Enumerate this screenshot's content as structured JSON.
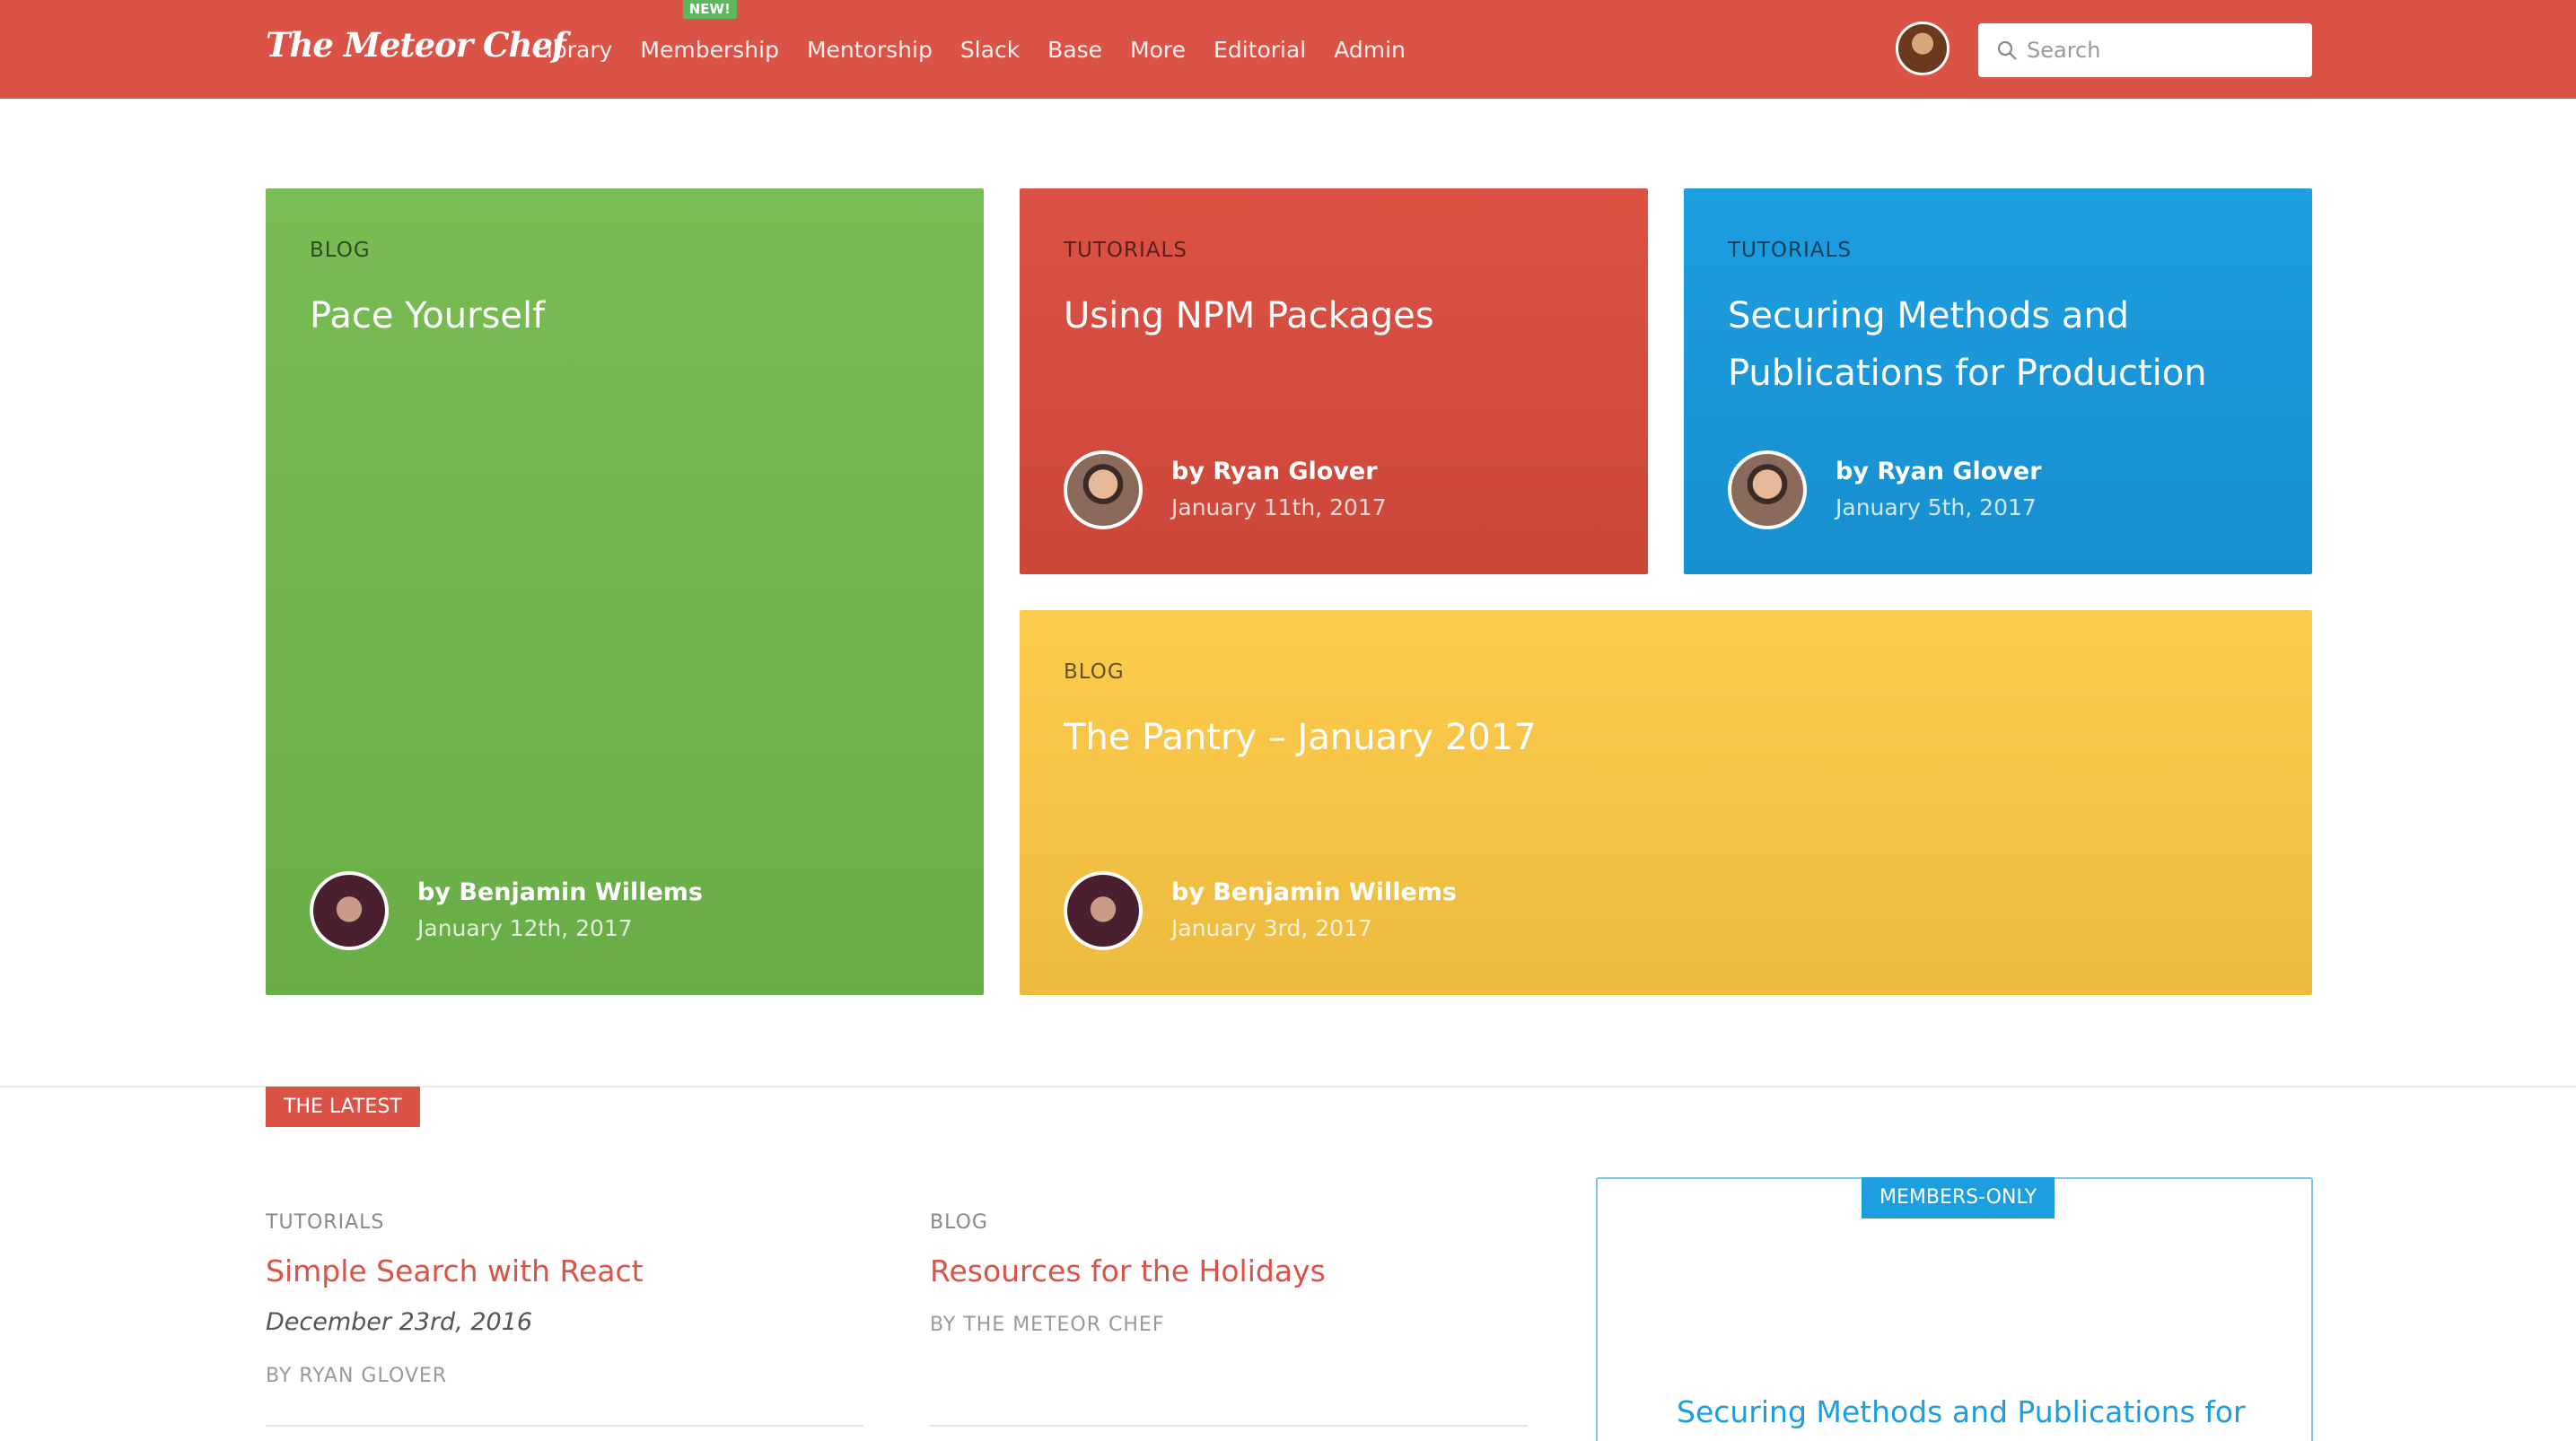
{
  "header": {
    "logo": "The Meteor Chef",
    "nav": [
      {
        "label": "Library"
      },
      {
        "label": "Membership",
        "badge": "NEW!"
      },
      {
        "label": "Mentorship"
      },
      {
        "label": "Slack"
      },
      {
        "label": "Base"
      },
      {
        "label": "More"
      },
      {
        "label": "Editorial"
      },
      {
        "label": "Admin"
      }
    ],
    "search_placeholder": "Search"
  },
  "featured": [
    {
      "category": "BLOG",
      "title": "Pace Yourself",
      "author": "by Benjamin Willems",
      "date": "January 12th, 2017",
      "color": "#72b84d"
    },
    {
      "category": "TUTORIALS",
      "title": "Using NPM Packages",
      "author": "by Ryan Glover",
      "date": "January 11th, 2017",
      "color": "#db5346"
    },
    {
      "category": "TUTORIALS",
      "title": "Securing Methods and Publications for Production",
      "author": "by Ryan Glover",
      "date": "January 5th, 2017",
      "color": "#1d9ee0"
    },
    {
      "category": "BLOG",
      "title": "The Pantry – January 2017",
      "author": "by Benjamin Willems",
      "date": "January 3rd, 2017",
      "color": "#f9c647"
    }
  ],
  "latest": {
    "tag": "THE LATEST",
    "posts": [
      {
        "category": "TUTORIALS",
        "title": "Simple Search with React",
        "date": "December 23rd, 2016",
        "byline": "BY RYAN GLOVER"
      },
      {
        "category": "BLOG",
        "title": "Resources for the Holidays",
        "byline": "BY THE METEOR CHEF"
      }
    ],
    "members": {
      "tag": "MEMBERS-ONLY",
      "title": "Securing Methods and Publications for"
    }
  }
}
